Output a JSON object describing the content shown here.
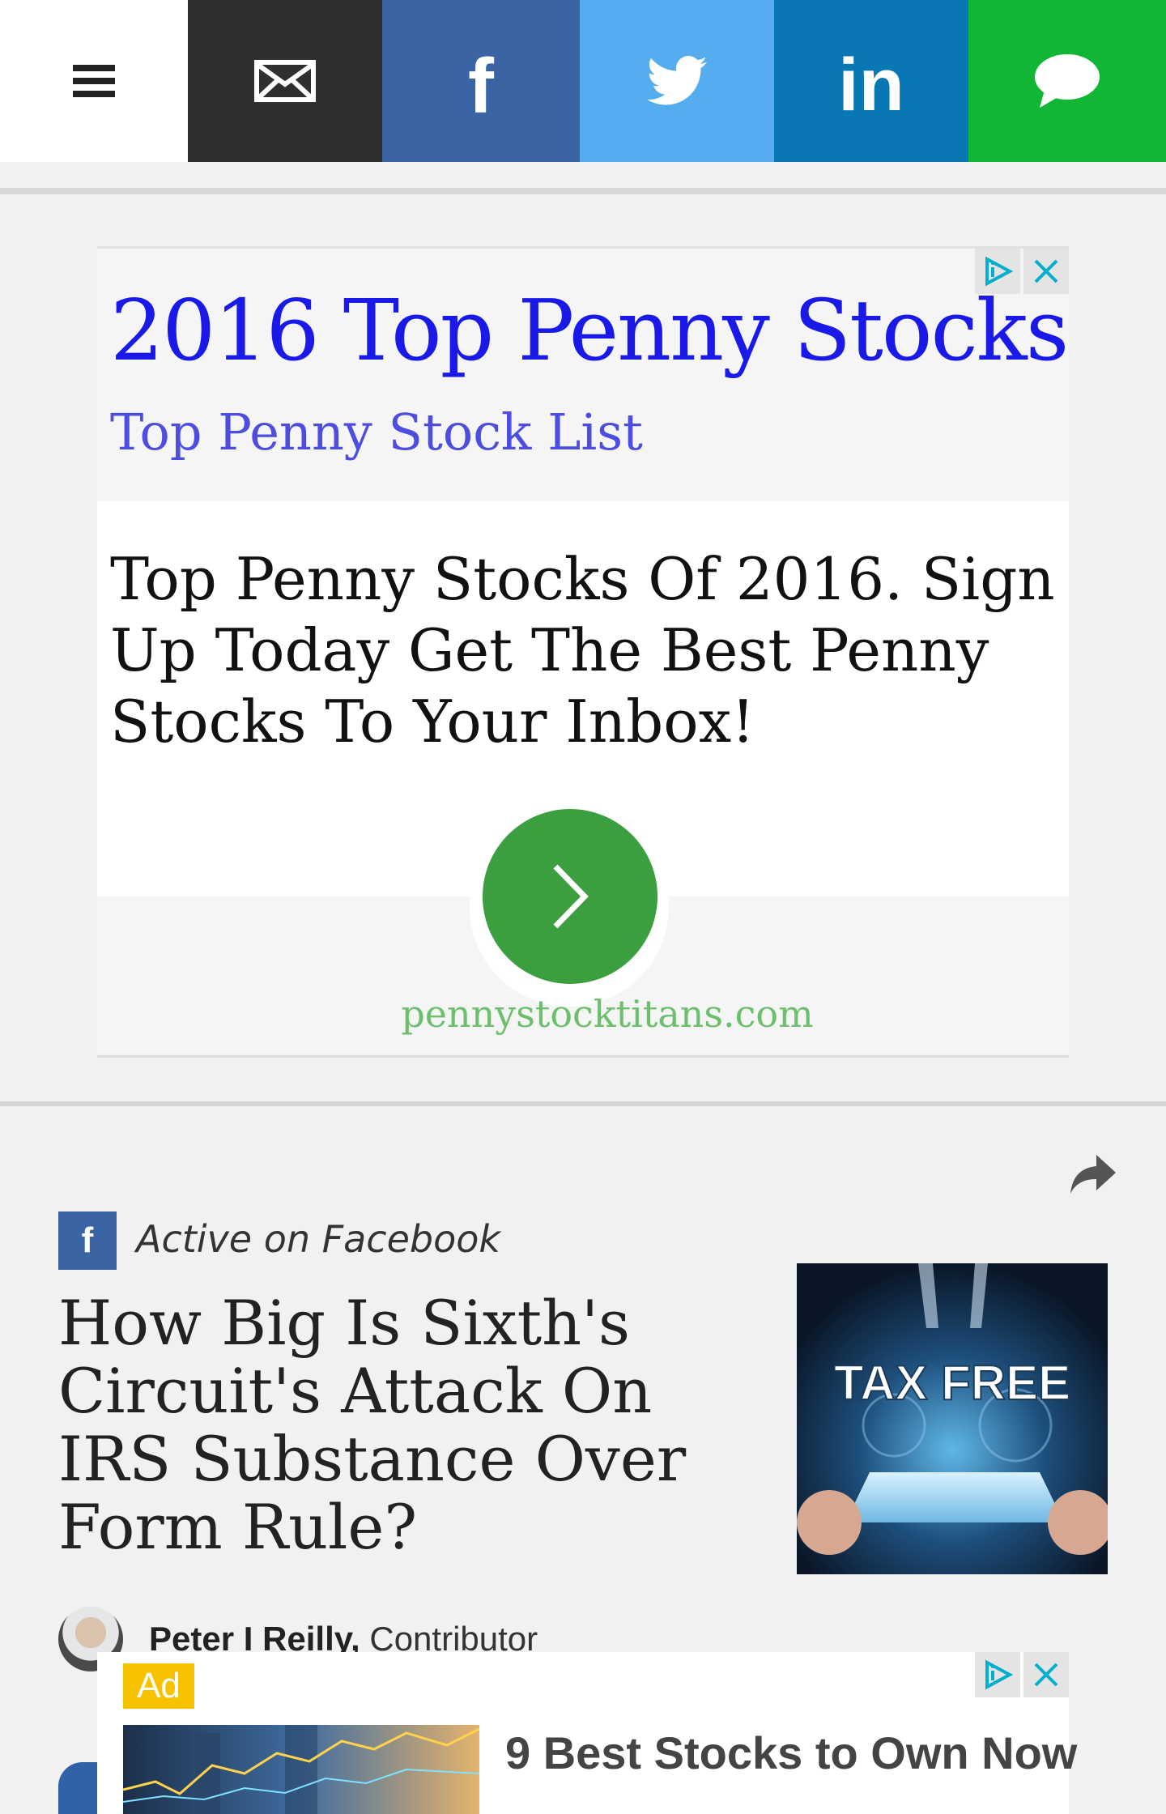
{
  "toolbar": {
    "menu_icon": "hamburger-menu-icon",
    "email_icon": "envelope-icon",
    "facebook_icon": "facebook-icon",
    "twitter_icon": "twitter-bird-icon",
    "linkedin_label": "in",
    "facebook_label": "f",
    "chat_icon": "speech-bubble-icon",
    "colors": {
      "menu": "#ffffff",
      "email": "#2f2f2f",
      "facebook": "#3b64a4",
      "twitter": "#55acee",
      "linkedin": "#0a77b5",
      "chat": "#11b635"
    }
  },
  "ad_top": {
    "title": "2016 Top Penny Stocks",
    "subtitle": "Top Penny Stock List",
    "body": "Top Penny Stocks Of 2016. Sign Up Today Get The Best Penny Stocks To Your Inbox!",
    "domain": "pennystocktitans.com",
    "adchoices_icon": "adchoices-icon",
    "close_icon": "close-icon",
    "cta_icon": "chevron-right-icon",
    "colors": {
      "title": "#1a1ae8",
      "subtitle": "#4d4ddf",
      "cta": "#3c9f3f",
      "domain": "#6cbf6c"
    }
  },
  "article": {
    "share_icon": "share-arrow-icon",
    "source_badge_label": "f",
    "source": "Active on Facebook",
    "headline": "How Big Is Sixth's Circuit's Attack On IRS Substance Over Form Rule?",
    "thumbnail_text": "TAX FREE",
    "author_name": "Peter I Reilly,",
    "author_role": "Contributor"
  },
  "ad_bottom": {
    "badge": "Ad",
    "title": "9 Best Stocks to Own Now",
    "adchoices_icon": "adchoices-icon",
    "close_icon": "close-icon",
    "badge_color": "#f7c200"
  }
}
